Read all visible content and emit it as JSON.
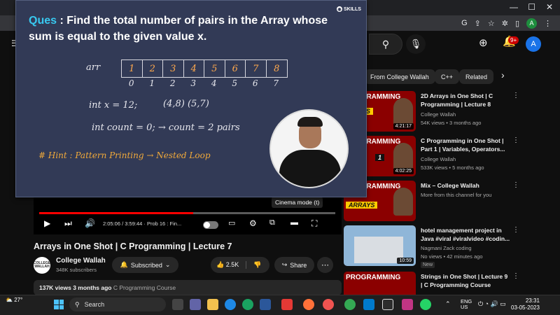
{
  "browser": {
    "user_initial": "A",
    "window_min": "—",
    "window_max": "☐",
    "window_close": "✕"
  },
  "header": {
    "notification_count": "9+",
    "user_initial": "A"
  },
  "chips": [
    "From College Wallah",
    "C++",
    "Related"
  ],
  "player": {
    "time": "2:05:06 / 3:59:44 · Prob 16 : Fin...",
    "progress_fraction": 0.52,
    "tooltip": "Cinema mode (t)"
  },
  "video": {
    "title": "Arrays in One Shot | C Programming | Lecture 7",
    "channel": "College Wallah",
    "channel_logo_text": "COLLEGE WALLAH",
    "subscribers": "348K subscribers",
    "subscribed_label": "Subscribed",
    "likes": "2.5K",
    "share_label": "Share",
    "views": "137K views",
    "age": "3 months ago",
    "category": "C Programming Course"
  },
  "slide": {
    "question_prefix": "Ques",
    "question_text": " : Find the total number of pairs in the Array whose sum is equal to the given value x.",
    "brand": "SKILLS",
    "arr_label": "arr",
    "arr_values": [
      "1",
      "2",
      "3",
      "4",
      "5",
      "6",
      "7",
      "8"
    ],
    "arr_indices": [
      "0",
      "1",
      "2",
      "3",
      "4",
      "5",
      "6",
      "7"
    ],
    "line_x": "int x = 12;",
    "pairs": "(4,8)  (5,7)",
    "line_count": "int count = 0;  →  count = 2 pairs",
    "hint": "# Hint : Pattern Printing → Nested Loop"
  },
  "recommendations": [
    {
      "thumb_title": "PROGRAMMING",
      "thumb_label": "RRAYS",
      "duration": "4:21:17",
      "title": "2D Arrays in One Shot | C Programming | Lecture 8",
      "channel": "College Wallah",
      "meta": "54K views • 3 months ago"
    },
    {
      "thumb_title": "PROGRAMMING",
      "thumb_label": "1",
      "duration": "4:02:25",
      "title": "C Programming in One Shot | Part 1 | Variables, Operators...",
      "channel": "College Wallah",
      "meta": "533K views • 5 months ago"
    },
    {
      "thumb_title": "PROGRAMMING",
      "thumb_label": "ARRAYS",
      "duration": "",
      "title": "Mix – College Wallah",
      "channel": "More from this channel for you",
      "meta": ""
    },
    {
      "thumb_title": "",
      "thumb_label": "",
      "duration": "10:59",
      "title": "hotel management project in Java #viral #viralvideo #codin...",
      "channel": "Nagmani Zack coding",
      "meta": "No views • 42 minutes ago",
      "badge": "New"
    },
    {
      "thumb_title": "PROGRAMMING",
      "thumb_label": "",
      "duration": "",
      "title": "Strings in One Shot | Lecture 9 | C Programming Course",
      "channel": "",
      "meta": ""
    }
  ],
  "taskbar": {
    "weather": "27°",
    "search_label": "Search",
    "lang_top": "ENG",
    "lang_bottom": "US",
    "time": "23:31",
    "date": "03-05-2023"
  },
  "colors": {
    "slide_bg": "#323a56",
    "accent_cyan": "#38c9f0",
    "accent_orange": "#ffa94d",
    "yt_red": "#ff0000"
  }
}
